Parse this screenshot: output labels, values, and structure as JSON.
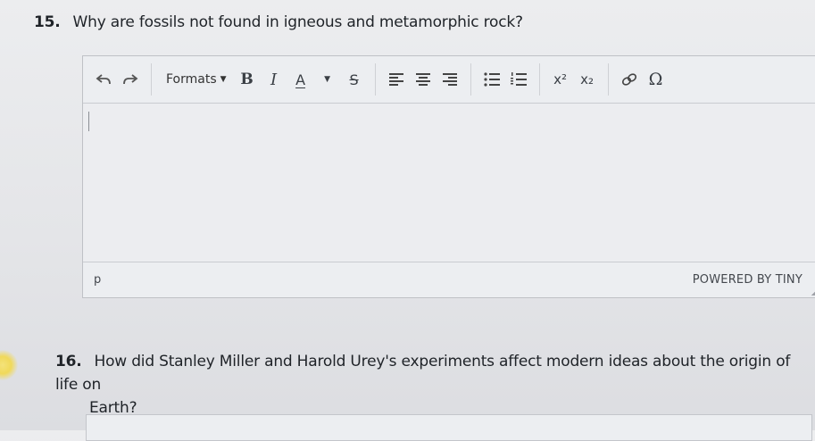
{
  "questions": [
    {
      "number": "15.",
      "text": "Why are fossils not found in igneous and metamorphic rock?"
    },
    {
      "number": "16.",
      "text_line1": "How did Stanley Miller and Harold Urey's experiments affect modern ideas about the origin of life on",
      "text_line2": "Earth?"
    }
  ],
  "toolbar": {
    "formats_label": "Formats",
    "bold_label": "B",
    "italic_label": "I",
    "forecolor_label": "A",
    "strike_label": "S",
    "sup_label": "x²",
    "sub_label": "x₂",
    "omega_label": "Ω",
    "icons": [
      "undo-icon",
      "redo-icon",
      "align-left-icon",
      "align-center-icon",
      "align-right-icon",
      "bullet-list-icon",
      "numbered-list-icon",
      "link-icon"
    ]
  },
  "statusbar": {
    "path": "p",
    "branding": "POWERED BY TINY"
  }
}
